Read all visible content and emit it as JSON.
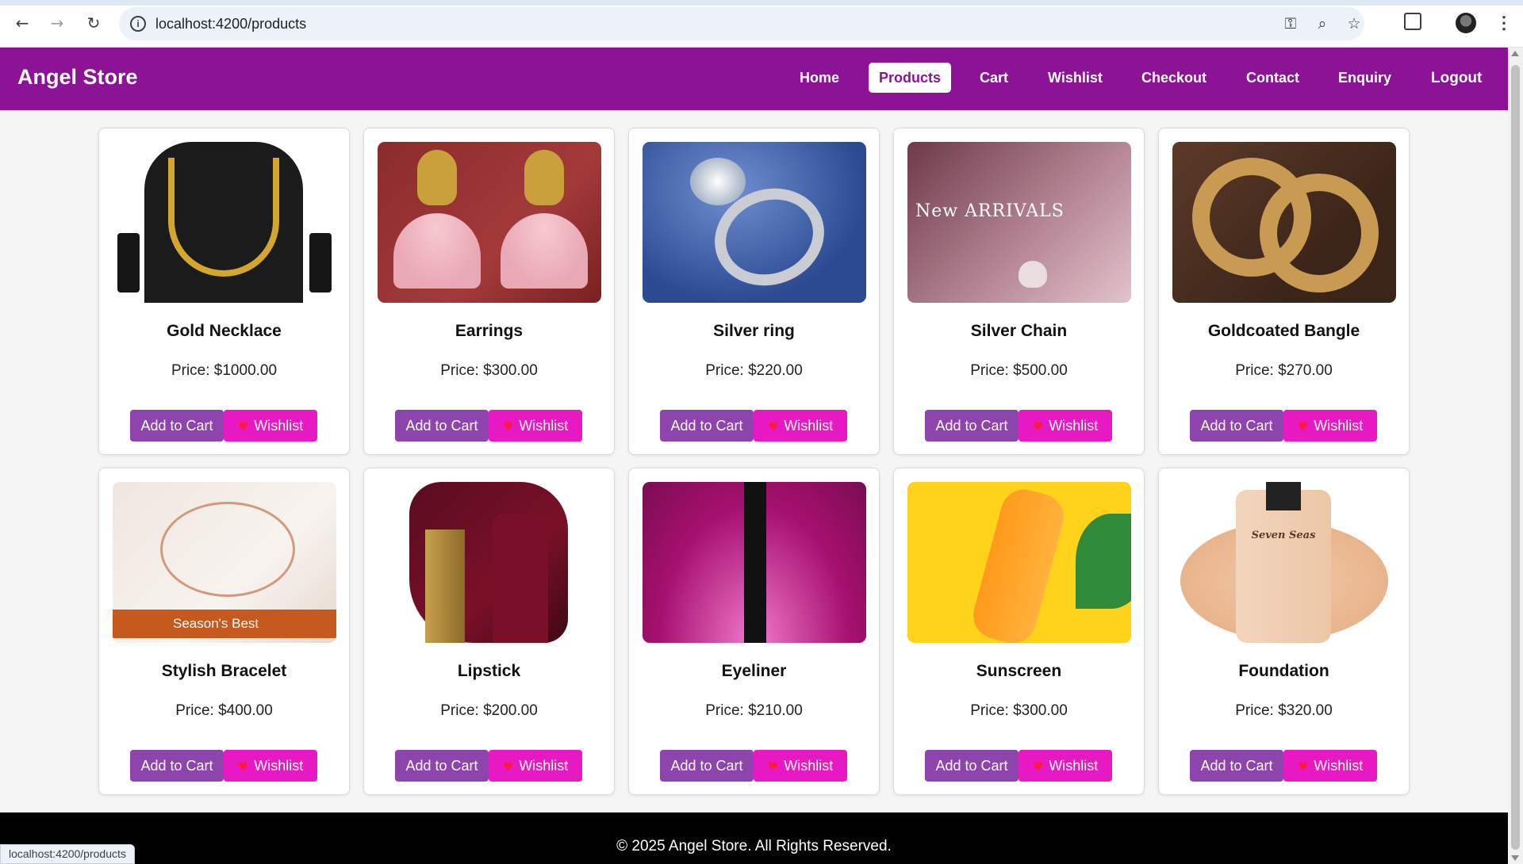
{
  "browser": {
    "url": "localhost:4200/products",
    "status_url": "localhost:4200/products"
  },
  "header": {
    "brand": "Angel Store",
    "nav": [
      "Home",
      "Products",
      "Cart",
      "Wishlist",
      "Checkout",
      "Contact",
      "Enquiry"
    ],
    "active_nav": "Products",
    "logout": "Logout"
  },
  "products": [
    {
      "name": "Gold Necklace",
      "price": "$1000.00"
    },
    {
      "name": "Earrings",
      "price": "$300.00"
    },
    {
      "name": "Silver ring",
      "price": "$220.00"
    },
    {
      "name": "Silver Chain",
      "price": "$500.00"
    },
    {
      "name": "Goldcoated Bangle",
      "price": "$270.00"
    },
    {
      "name": "Stylish Bracelet",
      "price": "$400.00"
    },
    {
      "name": "Lipstick",
      "price": "$200.00"
    },
    {
      "name": "Eyeliner",
      "price": "$210.00"
    },
    {
      "name": "Sunscreen",
      "price": "$300.00"
    },
    {
      "name": "Foundation",
      "price": "$320.00"
    }
  ],
  "labels": {
    "price_prefix": "Price: ",
    "add_to_cart": "Add to Cart",
    "wishlist": "Wishlist"
  },
  "image_text": {
    "chain_arrivals": "New ARRIVALS",
    "bracelet_banner": "Season's Best",
    "foundation_brand": "Seven Seas"
  },
  "footer": {
    "text": "© 2025 Angel Store. All Rights Reserved."
  },
  "colors": {
    "brand": "#8c1296",
    "cart_button": "#8e44ad",
    "wishlist_button": "#e619c2"
  }
}
